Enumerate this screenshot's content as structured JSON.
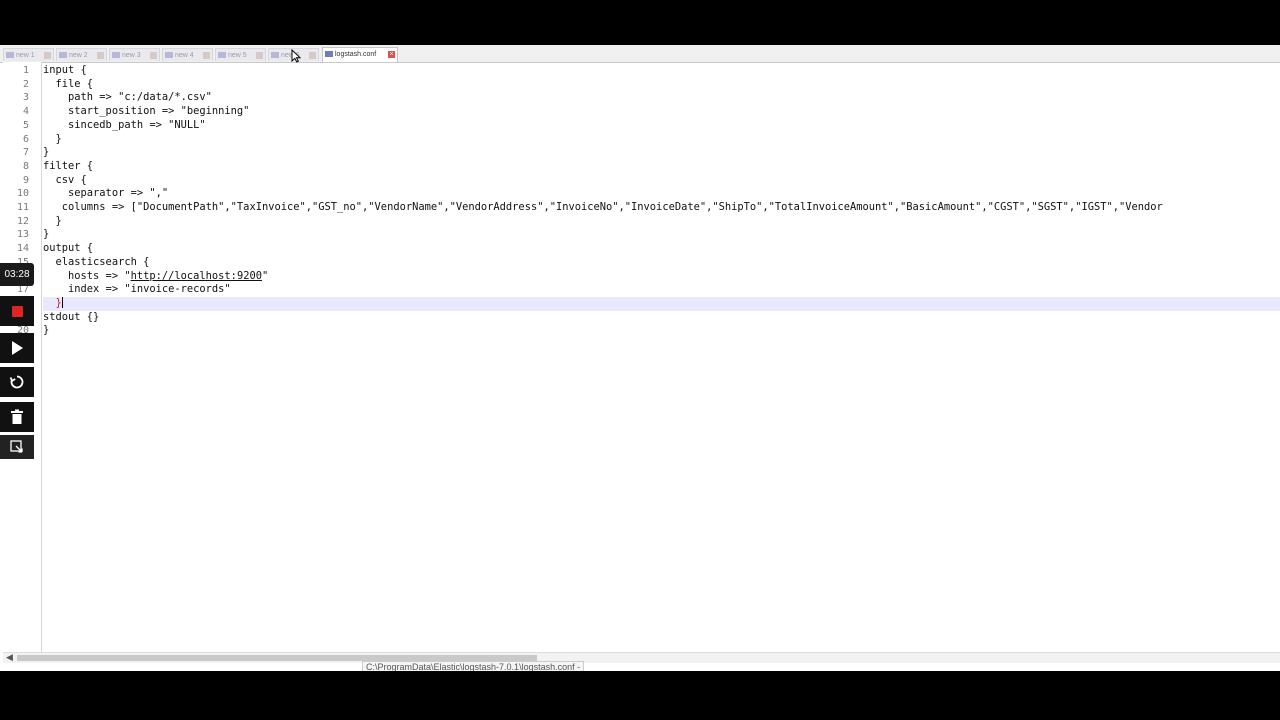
{
  "tabs": [
    {
      "label": "new 1",
      "active": false
    },
    {
      "label": "new 2",
      "active": false
    },
    {
      "label": "new 3",
      "active": false
    },
    {
      "label": "new 4",
      "active": false
    },
    {
      "label": "new 5",
      "active": false
    },
    {
      "label": "new 6",
      "active": false
    },
    {
      "label": "logstash.conf",
      "active": true
    }
  ],
  "code_lines": [
    {
      "num": "1",
      "text": "input {"
    },
    {
      "num": "2",
      "text": "  file {"
    },
    {
      "num": "3",
      "text": "    path => \"c:/data/*.csv\""
    },
    {
      "num": "4",
      "text": "    start_position => \"beginning\""
    },
    {
      "num": "5",
      "text": "    sincedb_path => \"NULL\""
    },
    {
      "num": "6",
      "text": "  }"
    },
    {
      "num": "7",
      "text": "}"
    },
    {
      "num": "8",
      "text": "filter {"
    },
    {
      "num": "9",
      "text": "  csv {"
    },
    {
      "num": "10",
      "text": "    separator => \",\""
    },
    {
      "num": "11",
      "text": "   columns => [\"DocumentPath\",\"TaxInvoice\",\"GST_no\",\"VendorName\",\"VendorAddress\",\"InvoiceNo\",\"InvoiceDate\",\"ShipTo\",\"TotalInvoiceAmount\",\"BasicAmount\",\"CGST\",\"SGST\",\"IGST\",\"Vendor"
    },
    {
      "num": "12",
      "text": "  }"
    },
    {
      "num": "13",
      "text": "}"
    },
    {
      "num": "14",
      "text": "output {"
    },
    {
      "num": "15",
      "text": "  elasticsearch {"
    },
    {
      "num": "16",
      "text": "    hosts => \"http://localhost:9200\""
    },
    {
      "num": "17",
      "text": "    index => \"invoice-records\""
    },
    {
      "num": "18",
      "text": "  }"
    },
    {
      "num": "19",
      "text": "stdout {}"
    },
    {
      "num": "20",
      "text": "}"
    }
  ],
  "hosts_url": "http://localhost:9200",
  "status_path": "C:\\ProgramData\\Elastic\\logstash-7.0.1\\logstash.conf -",
  "recorder": {
    "timer": "03:28"
  }
}
